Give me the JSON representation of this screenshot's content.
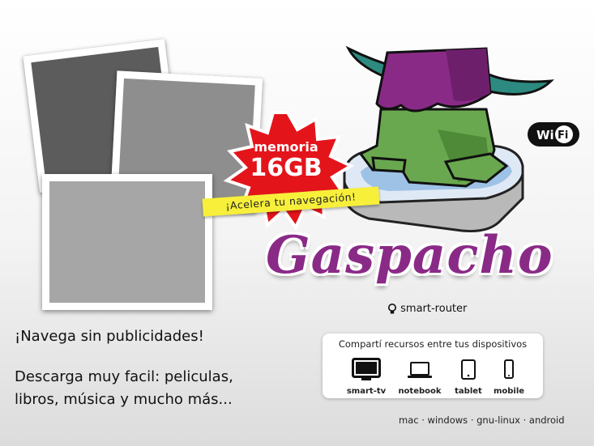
{
  "burst": {
    "line1": "memoria",
    "line2": "16GB",
    "color": "#e4141b"
  },
  "ribbon": {
    "text": "¡Acelera tu navegación!",
    "color": "#f7ef3a"
  },
  "brand": {
    "name": "Gaspacho",
    "subtitle": "smart-router",
    "color": "#8a2a87"
  },
  "badge": {
    "text": "WiFi"
  },
  "taglines": {
    "line1": "¡Navega sin publicidades!",
    "line2": "Descarga muy facil: peliculas, libros, música y mucho más..."
  },
  "share": {
    "title": "Compartí recursos entre tus dispositivos",
    "devices": [
      {
        "label": "smart-tv",
        "icon": "tv-icon"
      },
      {
        "label": "notebook",
        "icon": "laptop-icon"
      },
      {
        "label": "tablet",
        "icon": "tablet-icon"
      },
      {
        "label": "mobile",
        "icon": "phone-icon"
      }
    ]
  },
  "platforms": "mac · windows · gnu-linux · android"
}
